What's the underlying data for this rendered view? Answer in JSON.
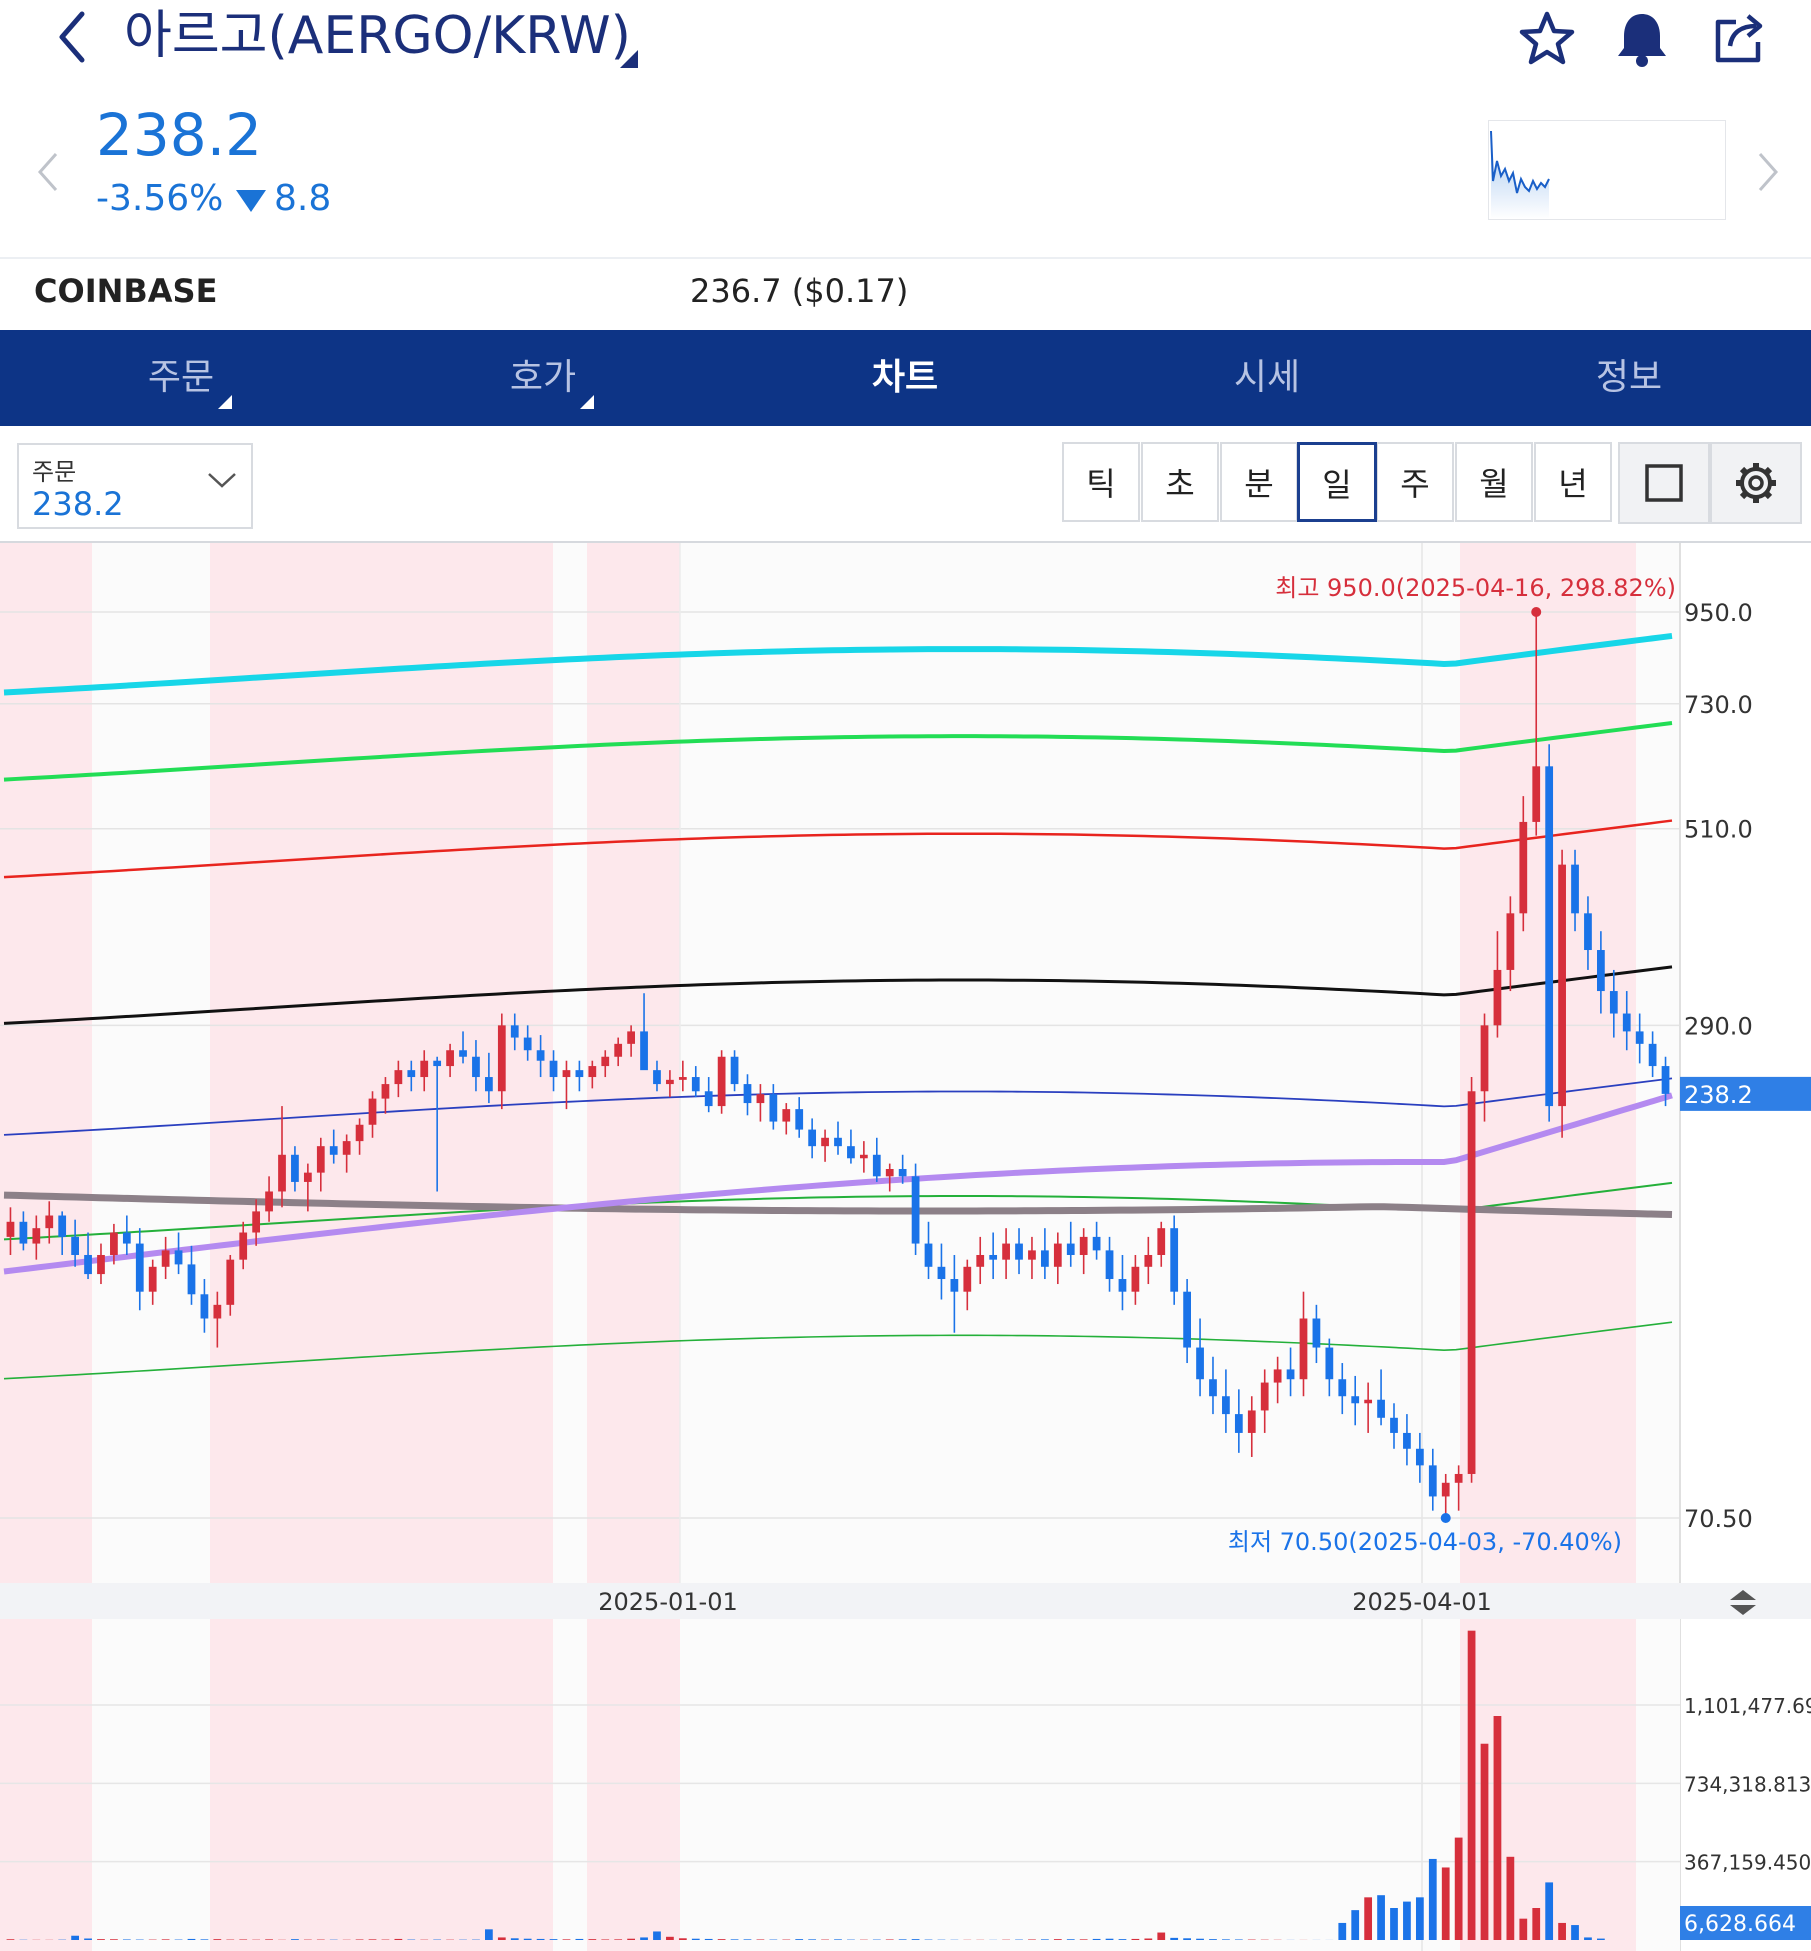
{
  "header": {
    "title": "아르고(AERGO/KRW)",
    "icons": [
      "back-icon",
      "star-icon",
      "bell-icon",
      "share-icon"
    ]
  },
  "price": {
    "current": "238.2",
    "change_pct": "-3.56%",
    "change_abs": "8.8",
    "direction": "down",
    "color": "#1a73d6"
  },
  "exchange": {
    "name": "COINBASE",
    "price": "236.7 ($0.17)"
  },
  "tabs": [
    {
      "label": "주문",
      "active": false,
      "has_caret": true
    },
    {
      "label": "호가",
      "active": false,
      "has_caret": true
    },
    {
      "label": "차트",
      "active": true,
      "has_caret": false
    },
    {
      "label": "시세",
      "active": false,
      "has_caret": false
    },
    {
      "label": "정보",
      "active": false,
      "has_caret": false
    }
  ],
  "order_select": {
    "label": "주문",
    "value": "238.2"
  },
  "periods": [
    "틱",
    "초",
    "분",
    "일",
    "주",
    "월",
    "년"
  ],
  "selected_period": "일",
  "chart_data": {
    "type": "candlestick",
    "scale": "log",
    "y_ticks": [
      "950.0",
      "730.0",
      "510.0",
      "290.0",
      "70.50"
    ],
    "y_tick_values": [
      950,
      730,
      510,
      290,
      70.5
    ],
    "current_price_label": "238.2",
    "x_ticks": [
      "2025-01-01",
      "2025-04-01"
    ],
    "high_annotation": "최고 950.0(2025-04-16, 298.82%)",
    "low_annotation": "최저 70.50(2025-04-03, -70.40%)",
    "volume_ticks": [
      "1,101,477.694",
      "734,318.813",
      "367,159.450"
    ],
    "volume_current_label": "6,628.664",
    "colors": {
      "up": "#d62f3c",
      "down": "#1a73e8",
      "band_cyan": "#17d6e8",
      "band_green_thick": "#22dd55",
      "band_red": "#e8241e",
      "band_black": "#111111",
      "band_blue": "#2a3fbf",
      "band_green_thin": "#24b03a",
      "ma_gray": "#8c8088",
      "ma_purple": "#b48af0",
      "shade": "#fde8ec"
    },
    "candles": [
      [
        158,
        172,
        150,
        165
      ],
      [
        165,
        170,
        152,
        155
      ],
      [
        155,
        168,
        148,
        162
      ],
      [
        162,
        175,
        155,
        168
      ],
      [
        168,
        170,
        150,
        158
      ],
      [
        158,
        166,
        145,
        150
      ],
      [
        150,
        160,
        140,
        142
      ],
      [
        142,
        155,
        138,
        150
      ],
      [
        150,
        164,
        146,
        160
      ],
      [
        160,
        168,
        150,
        155
      ],
      [
        155,
        162,
        128,
        135
      ],
      [
        135,
        148,
        130,
        145
      ],
      [
        145,
        158,
        140,
        152
      ],
      [
        152,
        160,
        142,
        146
      ],
      [
        146,
        154,
        130,
        134
      ],
      [
        134,
        140,
        120,
        125
      ],
      [
        125,
        135,
        115,
        130
      ],
      [
        130,
        150,
        126,
        148
      ],
      [
        148,
        165,
        144,
        160
      ],
      [
        160,
        176,
        154,
        170
      ],
      [
        170,
        188,
        165,
        180
      ],
      [
        180,
        230,
        172,
        200
      ],
      [
        200,
        205,
        180,
        185
      ],
      [
        185,
        195,
        170,
        190
      ],
      [
        190,
        210,
        180,
        205
      ],
      [
        205,
        215,
        195,
        200
      ],
      [
        200,
        212,
        190,
        208
      ],
      [
        208,
        222,
        200,
        218
      ],
      [
        218,
        240,
        210,
        235
      ],
      [
        235,
        250,
        225,
        245
      ],
      [
        245,
        262,
        236,
        255
      ],
      [
        255,
        262,
        240,
        250
      ],
      [
        250,
        270,
        240,
        262
      ],
      [
        262,
        265,
        180,
        258
      ],
      [
        258,
        275,
        250,
        270
      ],
      [
        270,
        285,
        260,
        265
      ],
      [
        265,
        278,
        240,
        250
      ],
      [
        250,
        268,
        232,
        240
      ],
      [
        240,
        300,
        228,
        290
      ],
      [
        290,
        300,
        270,
        280
      ],
      [
        280,
        290,
        262,
        270
      ],
      [
        270,
        282,
        250,
        262
      ],
      [
        262,
        270,
        240,
        250
      ],
      [
        250,
        262,
        228,
        255
      ],
      [
        255,
        262,
        240,
        250
      ],
      [
        250,
        262,
        242,
        258
      ],
      [
        258,
        270,
        250,
        265
      ],
      [
        265,
        280,
        258,
        275
      ],
      [
        275,
        290,
        265,
        285
      ],
      [
        285,
        318,
        270,
        255
      ],
      [
        255,
        262,
        240,
        245
      ],
      [
        245,
        255,
        236,
        248
      ],
      [
        248,
        262,
        240,
        250
      ],
      [
        250,
        258,
        236,
        240
      ],
      [
        240,
        250,
        226,
        230
      ],
      [
        230,
        270,
        225,
        265
      ],
      [
        265,
        270,
        240,
        245
      ],
      [
        245,
        252,
        224,
        232
      ],
      [
        232,
        245,
        220,
        238
      ],
      [
        238,
        245,
        215,
        220
      ],
      [
        220,
        232,
        212,
        228
      ],
      [
        228,
        236,
        210,
        215
      ],
      [
        215,
        222,
        198,
        205
      ],
      [
        205,
        215,
        196,
        210
      ],
      [
        210,
        220,
        200,
        205
      ],
      [
        205,
        215,
        195,
        198
      ],
      [
        198,
        208,
        190,
        200
      ],
      [
        200,
        210,
        185,
        188
      ],
      [
        188,
        195,
        180,
        192
      ],
      [
        192,
        200,
        184,
        188
      ],
      [
        188,
        195,
        150,
        155
      ],
      [
        155,
        165,
        140,
        145
      ],
      [
        145,
        155,
        132,
        140
      ],
      [
        140,
        150,
        120,
        135
      ],
      [
        135,
        148,
        128,
        145
      ],
      [
        145,
        158,
        138,
        150
      ],
      [
        150,
        160,
        140,
        148
      ],
      [
        148,
        162,
        140,
        155
      ],
      [
        155,
        162,
        142,
        148
      ],
      [
        148,
        158,
        140,
        152
      ],
      [
        152,
        162,
        140,
        145
      ],
      [
        145,
        160,
        138,
        155
      ],
      [
        155,
        165,
        145,
        150
      ],
      [
        150,
        162,
        142,
        158
      ],
      [
        158,
        165,
        148,
        152
      ],
      [
        152,
        158,
        135,
        140
      ],
      [
        140,
        150,
        128,
        135
      ],
      [
        135,
        150,
        130,
        145
      ],
      [
        145,
        158,
        138,
        150
      ],
      [
        150,
        165,
        145,
        162
      ],
      [
        162,
        168,
        130,
        135
      ],
      [
        135,
        140,
        110,
        115
      ],
      [
        115,
        125,
        100,
        105
      ],
      [
        105,
        112,
        95,
        100
      ],
      [
        100,
        108,
        90,
        95
      ],
      [
        95,
        102,
        85,
        90
      ],
      [
        90,
        100,
        84,
        96
      ],
      [
        96,
        108,
        90,
        104
      ],
      [
        104,
        112,
        98,
        108
      ],
      [
        108,
        115,
        100,
        105
      ],
      [
        105,
        135,
        100,
        125
      ],
      [
        125,
        130,
        110,
        115
      ],
      [
        115,
        118,
        100,
        105
      ],
      [
        105,
        110,
        95,
        100
      ],
      [
        100,
        106,
        92,
        98
      ],
      [
        98,
        104,
        90,
        99
      ],
      [
        99,
        108,
        92,
        94
      ],
      [
        94,
        98,
        86,
        90
      ],
      [
        90,
        95,
        82,
        86
      ],
      [
        86,
        90,
        78,
        82
      ],
      [
        82,
        86,
        72,
        75
      ],
      [
        75,
        80,
        70.5,
        78
      ],
      [
        78,
        82,
        72,
        80
      ],
      [
        80,
        250,
        78,
        240
      ],
      [
        240,
        300,
        220,
        290
      ],
      [
        290,
        380,
        280,
        340
      ],
      [
        340,
        420,
        320,
        400
      ],
      [
        400,
        560,
        380,
        520
      ],
      [
        520,
        950,
        500,
        610
      ],
      [
        610,
        650,
        220,
        230
      ],
      [
        230,
        480,
        210,
        460
      ],
      [
        460,
        480,
        380,
        400
      ],
      [
        400,
        420,
        340,
        360
      ],
      [
        360,
        380,
        300,
        320
      ],
      [
        320,
        340,
        280,
        300
      ],
      [
        300,
        320,
        270,
        285
      ],
      [
        285,
        300,
        260,
        275
      ],
      [
        275,
        285,
        250,
        258
      ],
      [
        258,
        265,
        230,
        238.2
      ]
    ],
    "volumes": [
      [
        0,
        3500
      ],
      [
        1,
        1200
      ],
      [
        2,
        900
      ],
      [
        3,
        800
      ],
      [
        4,
        1500
      ],
      [
        5,
        20000
      ],
      [
        6,
        7000
      ],
      [
        7,
        4000
      ],
      [
        8,
        3500
      ],
      [
        9,
        2500
      ],
      [
        10,
        2000
      ],
      [
        11,
        1800
      ],
      [
        12,
        3000
      ],
      [
        13,
        2000
      ],
      [
        14,
        5000
      ],
      [
        15,
        3000
      ],
      [
        16,
        4000
      ],
      [
        17,
        2000
      ],
      [
        18,
        2500
      ],
      [
        19,
        1500
      ],
      [
        20,
        3000
      ],
      [
        21,
        1000
      ],
      [
        22,
        4000
      ],
      [
        23,
        1800
      ],
      [
        24,
        2000
      ],
      [
        25,
        1500
      ],
      [
        26,
        1200
      ],
      [
        27,
        2500
      ],
      [
        28,
        3000
      ],
      [
        29,
        2000
      ],
      [
        30,
        5000
      ],
      [
        31,
        2000
      ],
      [
        32,
        1500
      ],
      [
        33,
        2000
      ],
      [
        34,
        1500
      ],
      [
        35,
        1500
      ],
      [
        36,
        1800
      ],
      [
        37,
        50000
      ],
      [
        38,
        12000
      ],
      [
        39,
        8000
      ],
      [
        40,
        6000
      ],
      [
        41,
        5000
      ],
      [
        42,
        4000
      ],
      [
        43,
        3000
      ],
      [
        44,
        5000
      ],
      [
        45,
        4000
      ],
      [
        46,
        2500
      ],
      [
        47,
        3000
      ],
      [
        48,
        6000
      ],
      [
        49,
        12000
      ],
      [
        50,
        40000
      ],
      [
        51,
        15000
      ],
      [
        52,
        8000
      ],
      [
        53,
        6000
      ],
      [
        54,
        5000
      ],
      [
        55,
        4000
      ],
      [
        56,
        3000
      ],
      [
        57,
        3000
      ],
      [
        58,
        2500
      ],
      [
        59,
        2000
      ],
      [
        60,
        2000
      ],
      [
        61,
        4000
      ],
      [
        62,
        3000
      ],
      [
        63,
        2000
      ],
      [
        64,
        3000
      ],
      [
        65,
        1800
      ],
      [
        66,
        1500
      ],
      [
        67,
        2000
      ],
      [
        68,
        2500
      ],
      [
        69,
        3000
      ],
      [
        70,
        4000
      ],
      [
        71,
        2000
      ],
      [
        72,
        1500
      ],
      [
        73,
        1200
      ],
      [
        74,
        1000
      ],
      [
        75,
        1000
      ],
      [
        76,
        800
      ],
      [
        77,
        1500
      ],
      [
        78,
        2000
      ],
      [
        79,
        2500
      ],
      [
        80,
        3000
      ],
      [
        81,
        4000
      ],
      [
        82,
        3500
      ],
      [
        83,
        3000
      ],
      [
        84,
        5000
      ],
      [
        85,
        6000
      ],
      [
        86,
        4000
      ],
      [
        87,
        5000
      ],
      [
        88,
        7000
      ],
      [
        89,
        35000
      ],
      [
        90,
        10000
      ],
      [
        91,
        8000
      ],
      [
        92,
        6000
      ],
      [
        93,
        4000
      ],
      [
        94,
        3000
      ],
      [
        95,
        2500
      ],
      [
        96,
        2000
      ],
      [
        97,
        1500
      ],
      [
        98,
        1000
      ],
      [
        99,
        500
      ],
      [
        100,
        500
      ],
      [
        101,
        400
      ],
      [
        102,
        300
      ],
      [
        103,
        80000
      ],
      [
        104,
        140000
      ],
      [
        105,
        200000
      ],
      [
        106,
        210000
      ],
      [
        107,
        150000
      ],
      [
        108,
        180000
      ],
      [
        109,
        200000
      ],
      [
        110,
        380000
      ],
      [
        111,
        340000
      ],
      [
        112,
        480000
      ],
      [
        113,
        1450000
      ],
      [
        114,
        920000
      ],
      [
        115,
        1050000
      ],
      [
        116,
        390000
      ],
      [
        117,
        100000
      ],
      [
        118,
        150000
      ],
      [
        119,
        270000
      ],
      [
        120,
        80000
      ],
      [
        121,
        70000
      ],
      [
        122,
        12000
      ],
      [
        123,
        6628
      ]
    ]
  }
}
